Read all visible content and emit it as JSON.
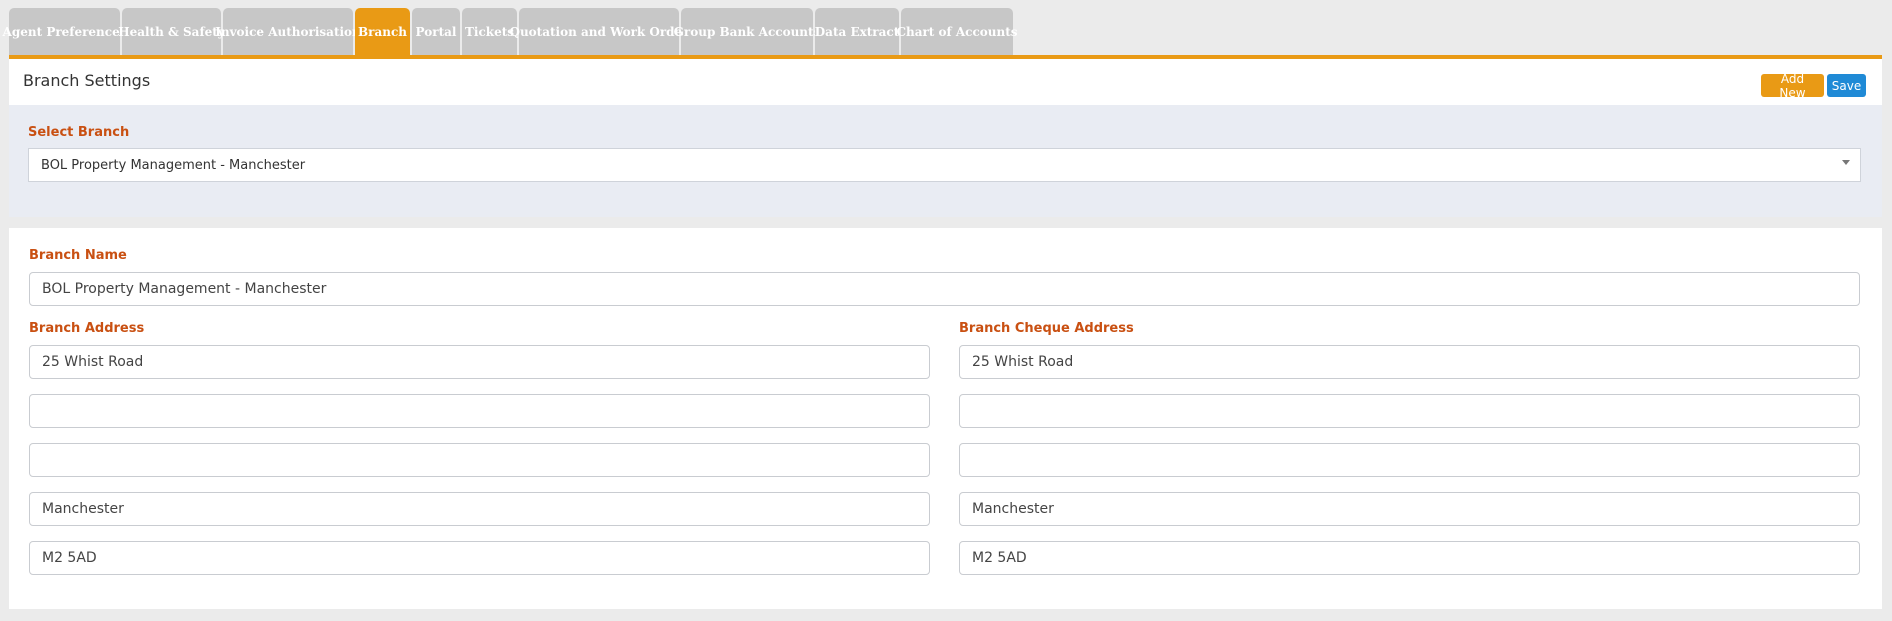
{
  "tabs": [
    {
      "label": "Agent Preferences",
      "active": false
    },
    {
      "label": "Health & Safety",
      "active": false
    },
    {
      "label": "Invoice Authorisation",
      "active": false
    },
    {
      "label": "Branch",
      "active": true
    },
    {
      "label": "Portal",
      "active": false
    },
    {
      "label": "Tickets",
      "active": false
    },
    {
      "label": "Quotation and Work Order",
      "active": false
    },
    {
      "label": "Group Bank Accounts",
      "active": false
    },
    {
      "label": "Data Extract",
      "active": false
    },
    {
      "label": "Chart of Accounts",
      "active": false
    }
  ],
  "header": {
    "title": "Branch Settings",
    "add_new_label": "Add New",
    "save_label": "Save"
  },
  "select_branch": {
    "label": "Select Branch",
    "value": "BOL Property Management - Manchester"
  },
  "form": {
    "branch_name_label": "Branch Name",
    "branch_name": "BOL Property Management - Manchester",
    "branch_address_label": "Branch Address",
    "branch_address": [
      "25 Whist Road",
      "",
      "",
      "Manchester",
      "M2 5AD"
    ],
    "cheque_address_label": "Branch Cheque Address",
    "cheque_address": [
      "25 Whist Road",
      "",
      "",
      "Manchester",
      "M2 5AD"
    ]
  },
  "colors": {
    "accent": "#e99a15",
    "save": "#1f8ad6",
    "label": "#c95012",
    "tab_inactive": "#c7c7c7"
  }
}
